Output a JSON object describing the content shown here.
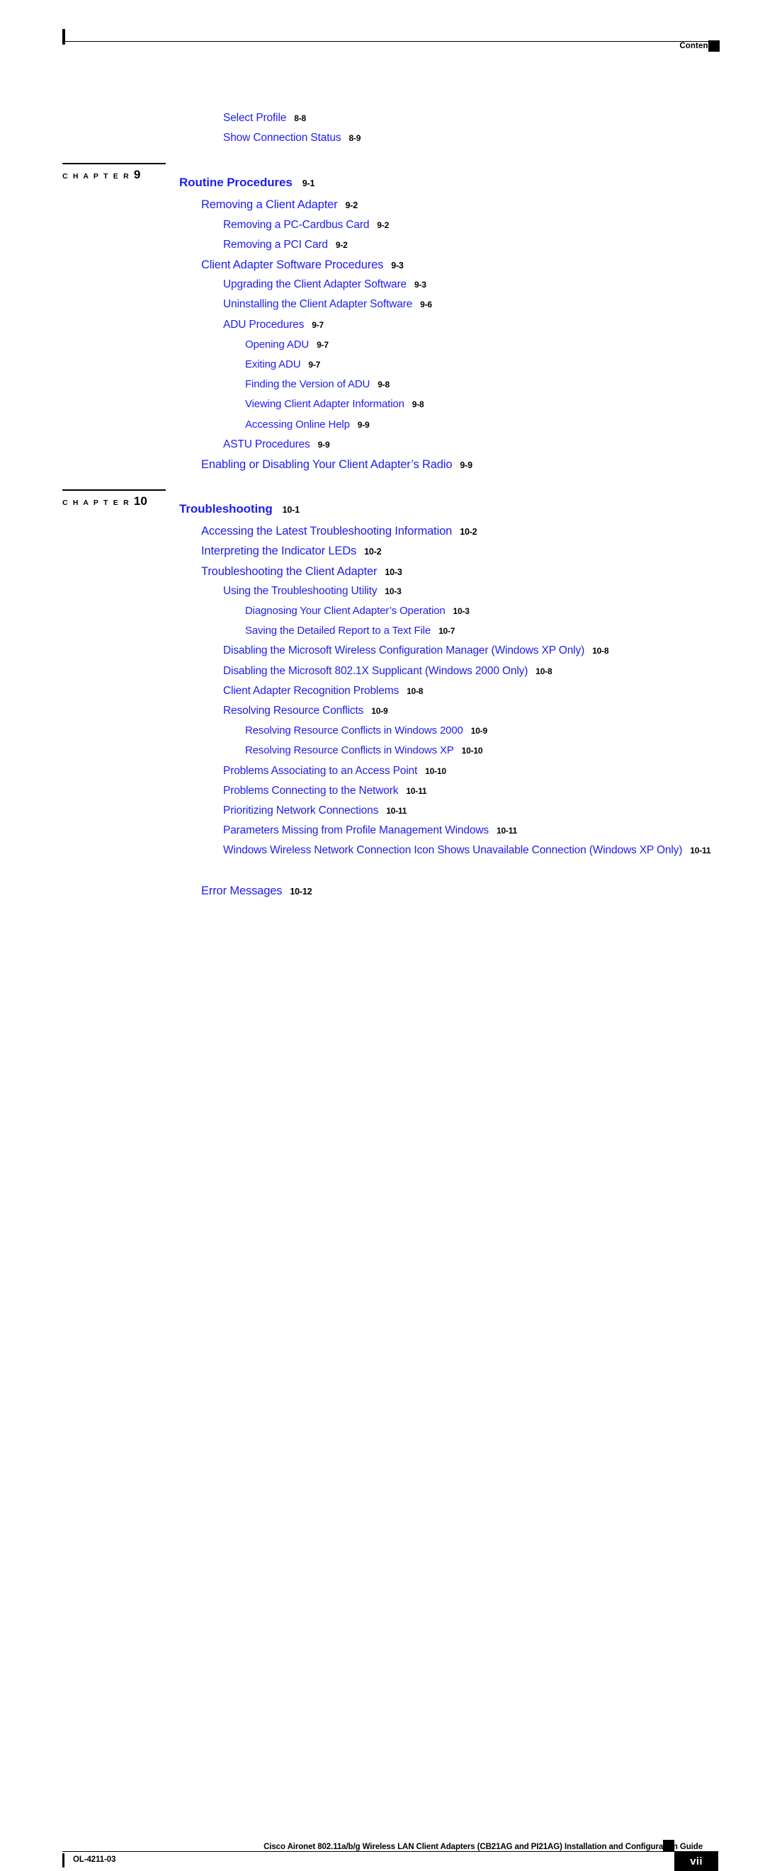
{
  "header": {
    "label": "Contents",
    "square_icon": "black-square-marker"
  },
  "footer": {
    "guide_title": "Cisco Aironet 802.11a/b/g Wireless LAN Client Adapters (CB21AG and PI21AG) Installation and Configuration Guide",
    "doc_id": "OL-4211-03",
    "page_number": "vii",
    "square_icon": "black-square-marker"
  },
  "colors": {
    "entry_blue": "#1d1df0",
    "page_number_black": "#000000",
    "marker_black": "#000000",
    "page_background": "#ffffff"
  },
  "toc": {
    "leading_entries": [
      {
        "title": "Select Profile",
        "page": "8-8",
        "level": 2
      },
      {
        "title": "Show Connection Status",
        "page": "8-9",
        "level": 2
      }
    ],
    "chapters": [
      {
        "marker_word": "C H A P T E R",
        "marker_number": "9",
        "title": "Routine Procedures",
        "page": "9-1",
        "entries": [
          {
            "title": "Removing a Client Adapter",
            "page": "9-2",
            "level": 1
          },
          {
            "title": "Removing a PC-Cardbus Card",
            "page": "9-2",
            "level": 2
          },
          {
            "title": "Removing a PCI Card",
            "page": "9-2",
            "level": 2
          },
          {
            "title": "Client Adapter Software Procedures",
            "page": "9-3",
            "level": 1
          },
          {
            "title": "Upgrading the Client Adapter Software",
            "page": "9-3",
            "level": 2
          },
          {
            "title": "Uninstalling the Client Adapter Software",
            "page": "9-6",
            "level": 2
          },
          {
            "title": "ADU Procedures",
            "page": "9-7",
            "level": 2
          },
          {
            "title": "Opening ADU",
            "page": "9-7",
            "level": 3
          },
          {
            "title": "Exiting ADU",
            "page": "9-7",
            "level": 3
          },
          {
            "title": "Finding the Version of ADU",
            "page": "9-8",
            "level": 3
          },
          {
            "title": "Viewing Client Adapter Information",
            "page": "9-8",
            "level": 3
          },
          {
            "title": "Accessing Online Help",
            "page": "9-9",
            "level": 3
          },
          {
            "title": "ASTU Procedures",
            "page": "9-9",
            "level": 2
          },
          {
            "title": "Enabling or Disabling Your Client Adapter’s Radio",
            "page": "9-9",
            "level": 1
          }
        ]
      },
      {
        "marker_word": "C H A P T E R",
        "marker_number": "10",
        "title": "Troubleshooting",
        "page": "10-1",
        "entries": [
          {
            "title": "Accessing the Latest Troubleshooting Information",
            "page": "10-2",
            "level": 1
          },
          {
            "title": "Interpreting the Indicator LEDs",
            "page": "10-2",
            "level": 1
          },
          {
            "title": "Troubleshooting the Client Adapter",
            "page": "10-3",
            "level": 1
          },
          {
            "title": "Using the Troubleshooting Utility",
            "page": "10-3",
            "level": 2
          },
          {
            "title": "Diagnosing Your Client Adapter’s Operation",
            "page": "10-3",
            "level": 3
          },
          {
            "title": "Saving the Detailed Report to a Text File",
            "page": "10-7",
            "level": 3
          },
          {
            "title": "Disabling the Microsoft Wireless Configuration Manager (Windows XP Only)",
            "page": "10-8",
            "level": 2
          },
          {
            "title": "Disabling the Microsoft 802.1X Supplicant (Windows 2000 Only)",
            "page": "10-8",
            "level": 2
          },
          {
            "title": "Client Adapter Recognition Problems",
            "page": "10-8",
            "level": 2
          },
          {
            "title": "Resolving Resource Conflicts",
            "page": "10-9",
            "level": 2
          },
          {
            "title": "Resolving Resource Conflicts in Windows 2000",
            "page": "10-9",
            "level": 3
          },
          {
            "title": "Resolving Resource Conflicts in Windows XP",
            "page": "10-10",
            "level": 3
          },
          {
            "title": "Problems Associating to an Access Point",
            "page": "10-10",
            "level": 2
          },
          {
            "title": "Problems Connecting to the Network",
            "page": "10-11",
            "level": 2
          },
          {
            "title": "Prioritizing Network Connections",
            "page": "10-11",
            "level": 2
          },
          {
            "title": "Parameters Missing from Profile Management Windows",
            "page": "10-11",
            "level": 2
          },
          {
            "title": "Windows Wireless Network Connection Icon Shows Unavailable Connection (Windows XP Only)",
            "page": "10-11",
            "level": 2,
            "wrapped": true
          },
          {
            "title": "Error Messages",
            "page": "10-12",
            "level": 1
          }
        ]
      }
    ]
  }
}
